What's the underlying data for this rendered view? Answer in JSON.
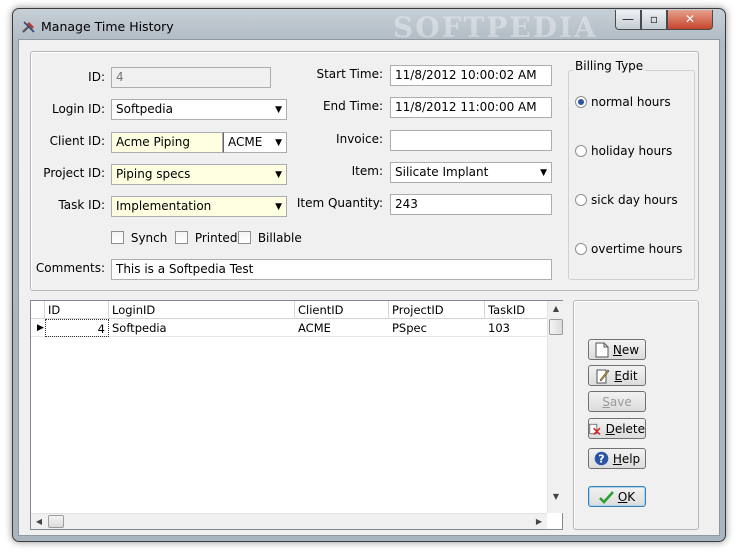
{
  "window": {
    "title": "Manage Time History",
    "watermark": "SOFTPEDIA",
    "controls": {
      "minimize": "—",
      "maximize": "▫",
      "close": "✕"
    }
  },
  "form": {
    "id": {
      "label": "ID:",
      "value": "4"
    },
    "login_id": {
      "label": "Login ID:",
      "value": "Softpedia"
    },
    "client_id": {
      "label": "Client ID:",
      "value": "Acme Piping",
      "code": "ACME"
    },
    "project_id": {
      "label": "Project ID:",
      "value": "Piping specs"
    },
    "task_id": {
      "label": "Task ID:",
      "value": "Implementation"
    },
    "start_time": {
      "label": "Start Time:",
      "value": "11/8/2012 10:00:02 AM"
    },
    "end_time": {
      "label": "End Time:",
      "value": "11/8/2012 11:00:00 AM"
    },
    "invoice": {
      "label": "Invoice:",
      "value": ""
    },
    "item": {
      "label": "Item:",
      "value": "Silicate Implant"
    },
    "item_quantity": {
      "label": "Item Quantity:",
      "value": "243"
    },
    "checkboxes": {
      "synch": "Synch",
      "printed": "Printed",
      "billable": "Billable"
    },
    "comments": {
      "label": "Comments:",
      "value": "This is a Softpedia Test"
    }
  },
  "billing": {
    "title": "Billing Type",
    "options": [
      "normal hours",
      "holiday hours",
      "sick day hours",
      "overtime hours"
    ],
    "selected": "normal hours"
  },
  "grid": {
    "columns": [
      "ID",
      "LoginID",
      "ClientID",
      "ProjectID",
      "TaskID"
    ],
    "rows": [
      {
        "id": "4",
        "login": "Softpedia",
        "client": "ACME",
        "project": "PSpec",
        "task": "103"
      }
    ],
    "row_indicator": "▶"
  },
  "buttons": {
    "new": {
      "prefix": "",
      "key": "N",
      "rest": "ew"
    },
    "edit": {
      "prefix": "",
      "key": "E",
      "rest": "dit"
    },
    "save": {
      "prefix": "",
      "key": "S",
      "rest": "ave"
    },
    "delete": {
      "prefix": "",
      "key": "D",
      "rest": "elete"
    },
    "help": {
      "prefix": "",
      "key": "H",
      "rest": "elp"
    },
    "ok": {
      "prefix": "",
      "key": "O",
      "rest": "K"
    }
  },
  "colors": {
    "accent": "#2b56a5",
    "required_field": "#ffffe1",
    "ok_check": "#2ca02c",
    "delete_x": "#d62728"
  }
}
